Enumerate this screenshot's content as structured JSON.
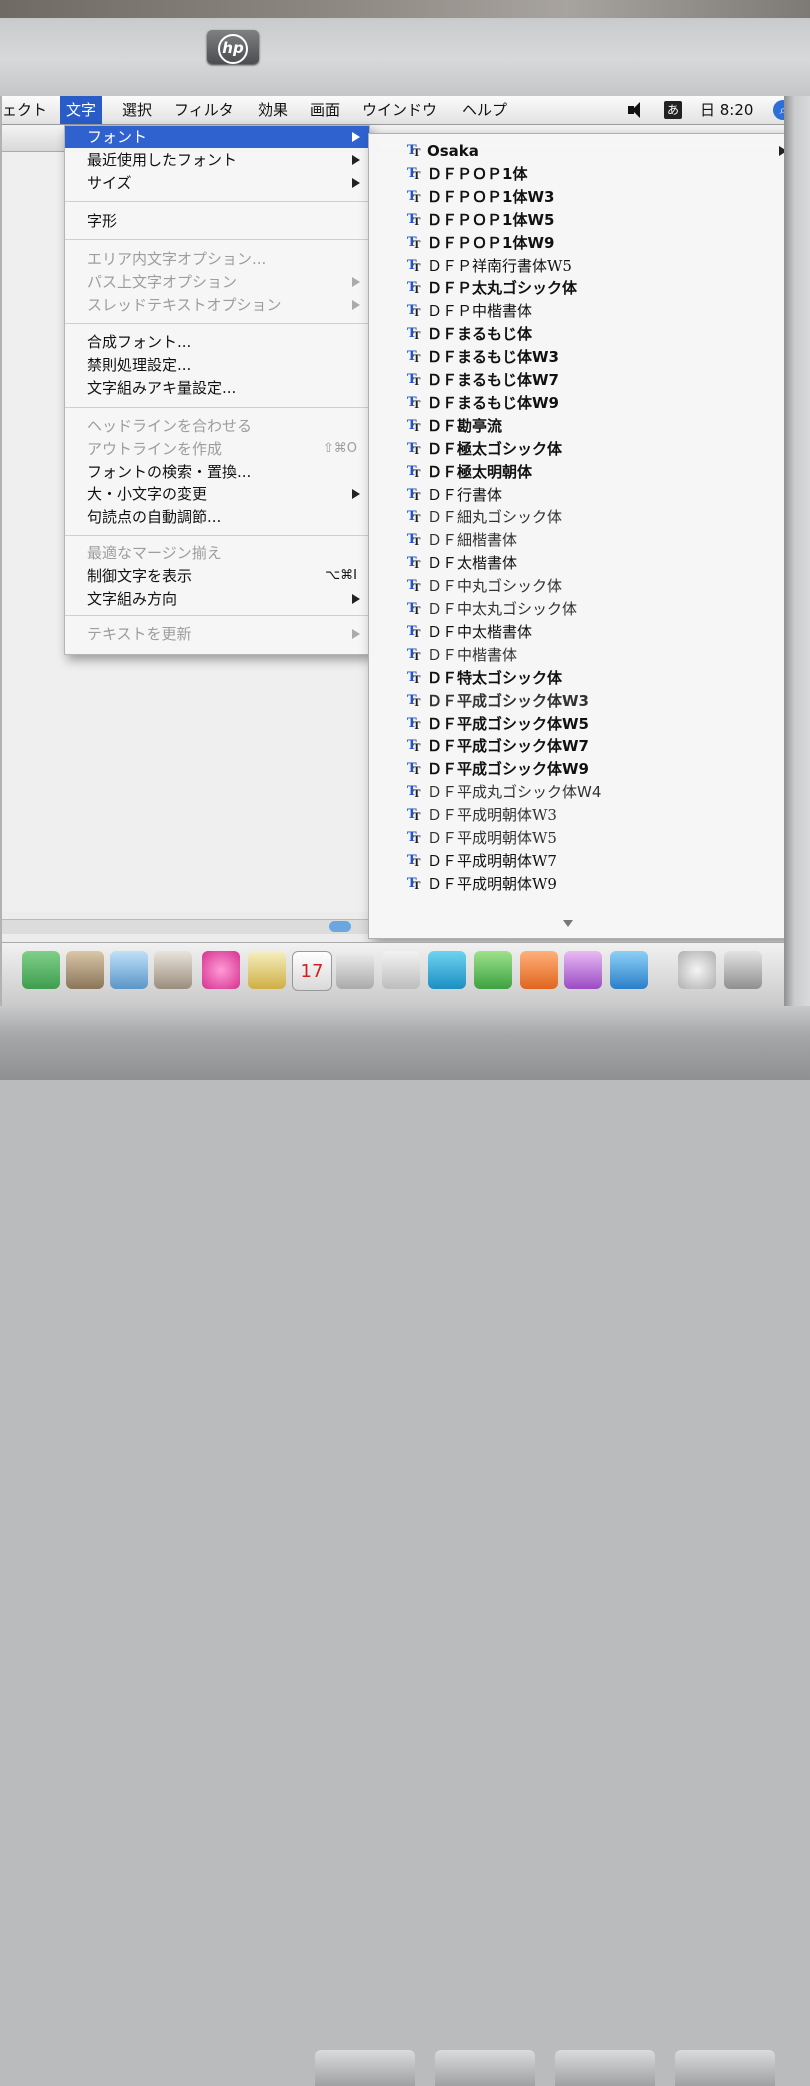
{
  "menubar": {
    "items": [
      "ェクト",
      "文字",
      "選択",
      "フィルタ",
      "効果",
      "画面",
      "ウインドウ",
      "ヘルプ"
    ],
    "active_index": 1,
    "input_mode": "あ",
    "clock": "日 8:20"
  },
  "mainmenu": {
    "font": "フォント",
    "recent_fonts": "最近使用したフォント",
    "size": "サイズ",
    "glyphs": "字形",
    "area_type": "エリア内文字オプション...",
    "path_type": "パス上文字オプション",
    "thread_text": "スレッドテキストオプション",
    "composite_font": "合成フォント...",
    "kinsoku": "禁則処理設定...",
    "mojikumi": "文字組みアキ量設定...",
    "fit_headline": "ヘッドラインを合わせる",
    "create_outlines": "アウトラインを作成",
    "create_outlines_shortcut": "⇧⌘O",
    "find_font": "フォントの検索・置換...",
    "change_case": "大・小文字の変更",
    "smart_punct": "句読点の自動調節...",
    "optical_margin": "最適なマージン揃え",
    "show_hidden": "制御文字を表示",
    "show_hidden_shortcut": "⌥⌘I",
    "orientation": "文字組み方向",
    "update_text": "テキストを更新"
  },
  "fonts": [
    "Osaka",
    "ＤＦＰＯＰ1体",
    "ＤＦＰＯＰ1体W3",
    "ＤＦＰＯＰ1体W5",
    "ＤＦＰＯＰ1体W9",
    "ＤＦＰ祥南行書体W5",
    "ＤＦＰ太丸ゴシック体",
    "ＤＦＰ中楷書体",
    "ＤＦまるもじ体",
    "ＤＦまるもじ体W3",
    "ＤＦまるもじ体W7",
    "ＤＦまるもじ体W9",
    "ＤＦ勘亭流",
    "ＤＦ極太ゴシック体",
    "ＤＦ極太明朝体",
    "ＤＦ行書体",
    "ＤＦ細丸ゴシック体",
    "ＤＦ細楷書体",
    "ＤＦ太楷書体",
    "ＤＦ中丸ゴシック体",
    "ＤＦ中太丸ゴシック体",
    "ＤＦ中太楷書体",
    "ＤＦ中楷書体",
    "ＤＦ特太ゴシック体",
    "ＤＦ平成ゴシック体W3",
    "ＤＦ平成ゴシック体W5",
    "ＤＦ平成ゴシック体W7",
    "ＤＦ平成ゴシック体W9",
    "ＤＦ平成丸ゴシック体W4",
    "ＤＦ平成明朝体W3",
    "ＤＦ平成明朝体W5",
    "ＤＦ平成明朝体W7",
    "ＤＦ平成明朝体W9"
  ],
  "font_icon": "truetype-icon",
  "accent": "#2f62cf",
  "brand": "hp"
}
